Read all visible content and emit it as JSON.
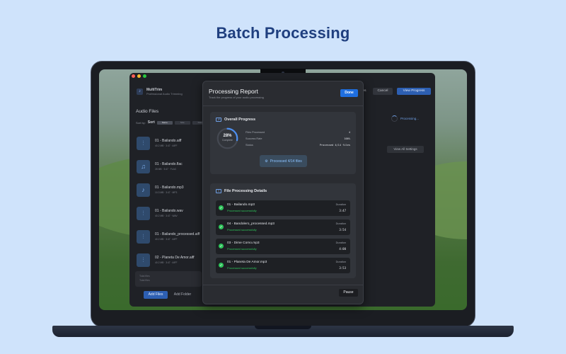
{
  "headline": "Batch Processing",
  "app": {
    "name": "MultiTrim",
    "subtitle": "Professional Audio Trimming",
    "section_title": "Audio Files",
    "sort_label": "Sort by:",
    "sort_value": "Sort",
    "sort_options": [
      "Name",
      "Size",
      "Date"
    ],
    "files": [
      {
        "name": "01 - Bailando.aiff",
        "icon": "waveform-icon",
        "meta": "40.2 MB  ·  3:47  ·  AIFF"
      },
      {
        "name": "01 - Bailando.flac",
        "icon": "music-notes-icon",
        "meta": "28 MB  ·  3:47  ·  FLAC"
      },
      {
        "name": "01 - Bailando.mp3",
        "icon": "music-note-icon",
        "meta": "10.3 MB  ·  3:47  ·  MP3"
      },
      {
        "name": "01 - Bailando.wav",
        "icon": "waveform-icon",
        "meta": "40.2 MB  ·  3:47  ·  WAV"
      },
      {
        "name": "01 - Bailando_processed.aiff",
        "icon": "waveform-icon",
        "meta": "40.2 MB  ·  3:47  ·  AIFF"
      },
      {
        "name": "02 - Planeta De Amor.aiff",
        "icon": "waveform-icon",
        "meta": "40.2 MB  ·  3:47  ·  AIFF"
      }
    ],
    "queue_lines": [
      "Total files",
      "Total files"
    ],
    "add_files": "Add Files",
    "add_folder": "Add Folder",
    "top_buttons": {
      "partial": "es",
      "cancel": "Cancel",
      "view_progress": "View Progress"
    },
    "processing_status": "Processing...",
    "view_all_settings": "View All Settings"
  },
  "modal": {
    "title": "Processing Report",
    "subtitle": "Track the progress of your audio processing",
    "done": "Done",
    "overall": {
      "heading": "Overall Progress",
      "percent_label": "28%",
      "complete_label": "Complete",
      "progress_value": 0.28,
      "stats": [
        {
          "label": "Files Processed",
          "value": "4"
        },
        {
          "label": "Success Rate",
          "value": "100%"
        },
        {
          "label": "Status",
          "value": "Processed 4/14 files"
        }
      ],
      "pill": "Processed 4/14 files"
    },
    "details": {
      "heading": "File Processing Details",
      "duration_label": "Duration",
      "rows": [
        {
          "name": "01 - Bailando.mp3",
          "status": "Processed successfully",
          "duration": "3:47"
        },
        {
          "name": "04 - Bandolero_processed.mp3",
          "status": "Processed successfully",
          "duration": "3:54"
        },
        {
          "name": "03 - Dime Como.mp3",
          "status": "Processed successfully",
          "duration": "4:00"
        },
        {
          "name": "01 - Planeta De Amor.mp3",
          "status": "Processed successfully",
          "duration": "3:53"
        }
      ]
    },
    "pause": "Pause"
  },
  "colors": {
    "accent": "#1f6fe0",
    "success": "#2ec45a",
    "background": "#cfe3fb",
    "headline": "#1f3f7f"
  }
}
